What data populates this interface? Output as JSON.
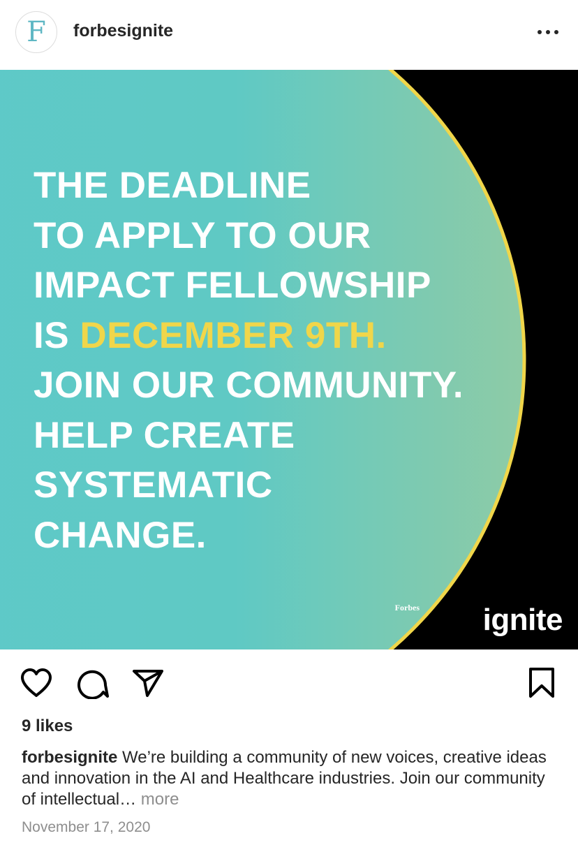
{
  "post": {
    "username": "forbesignite",
    "avatar_letter": "F",
    "image": {
      "headline_lines": [
        "THE DEADLINE",
        "TO APPLY TO OUR",
        "IMPACT FELLOWSHIP"
      ],
      "highlight_prefix": "IS ",
      "highlight_text": "DECEMBER 9TH.",
      "headline_lines_after": [
        "JOIN OUR COMMUNITY.",
        "HELP CREATE",
        "SYSTEMATIC",
        "CHANGE."
      ],
      "brand_small": "Forbes",
      "brand_big": "ignite",
      "colors": {
        "teal": "#5ec9cb",
        "highlight": "#f0d64a",
        "ring": "#f0d64a",
        "background": "#000000"
      }
    },
    "actions": {
      "like": "heart-icon",
      "comment": "comment-icon",
      "share": "send-icon",
      "save": "bookmark-icon"
    },
    "likes": "9 likes",
    "caption": {
      "user": "forbesignite",
      "text": " We’re building a community of new voices, creative ideas and innovation in the AI and Healthcare industries. Join our community of intellectual…",
      "more": " more"
    },
    "date": "November 17, 2020"
  }
}
